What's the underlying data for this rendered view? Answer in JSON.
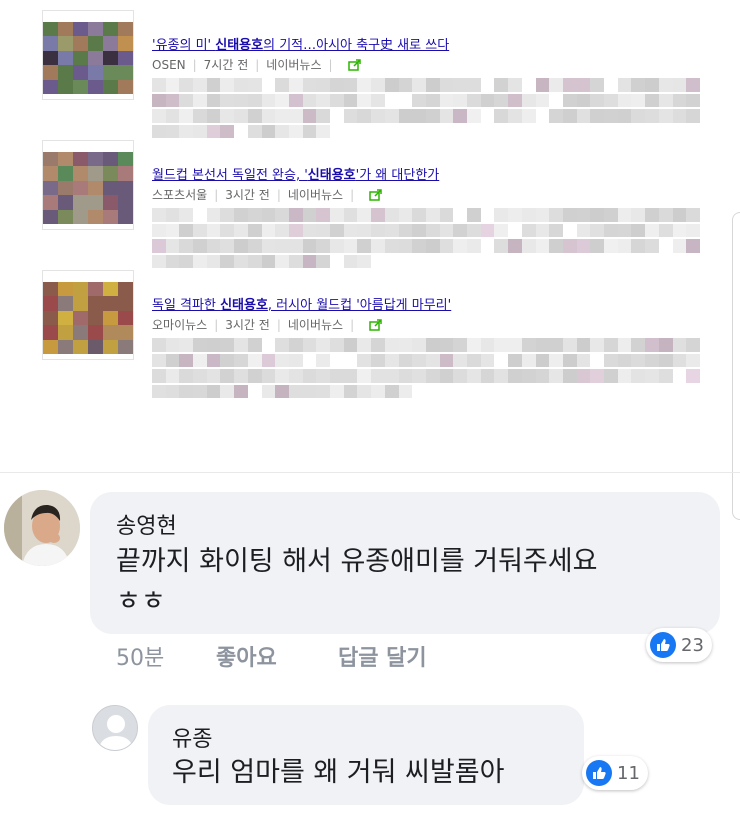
{
  "news": [
    {
      "title_parts": [
        "'유종의 미' ",
        "신태용호",
        "의 기적…아시아 축구史 새로 쓰다"
      ],
      "source": "OSEN",
      "time": "7시간 전",
      "portal": "네이버뉴스"
    },
    {
      "title_parts": [
        "월드컵 본선서 독일전 완승, '",
        "신태용호",
        "'가 왜 대단한가"
      ],
      "source": "스포츠서울",
      "time": "3시간 전",
      "portal": "네이버뉴스"
    },
    {
      "title_parts": [
        "독일 격파한 ",
        "신태용호",
        ", 러시아 월드컵 '아름답게 마무리'"
      ],
      "source": "오마이뉴스",
      "time": "3시간 전",
      "portal": "네이버뉴스"
    }
  ],
  "comment": {
    "author": "송영현",
    "text_line1": "끝까지 화이팅 해서 유종애미를 거둬주세요",
    "text_line2": "ㅎㅎ",
    "time": "50분",
    "like_label": "좋아요",
    "reply_label": "답글 달기",
    "reactions": "23"
  },
  "reply": {
    "author": "유종",
    "text": "우리 엄마를 왜 거둬 씨발롬아",
    "reactions": "11"
  },
  "colors": {
    "link": "#1a0dab",
    "bubble": "#f0f2f5",
    "like_blue": "#1877f2",
    "share_green": "#2db400"
  }
}
